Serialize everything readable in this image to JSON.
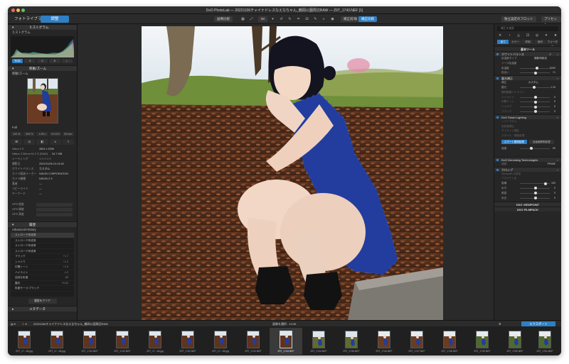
{
  "window": {
    "title": "DxO PhotoLab — 20221106チャイナドレスなえなちゃん_鶴岡公園周辺RAW — Z9T_1743.NEF [1]"
  },
  "toolbar": {
    "tab_library": "フォトライブラリ",
    "tab_customize": "調整",
    "btn_compare": "画像比較",
    "zoom_value": "50",
    "btn_before": "補正前/後",
    "btn_style": "補正比較",
    "btn_favorite": "独立設定のフロット",
    "btn_preset": "プリセット"
  },
  "left": {
    "histogram_title": "ヒストグラム",
    "histogram_sub": "ヒストグラム",
    "histogram_channels": [
      "RGB",
      "R",
      "G",
      "B",
      "L"
    ],
    "move_zoom_title": "移動/ズーム",
    "move_zoom_sub": "移動/ズーム",
    "zoom_label": "Full",
    "zoom_buttons": [
      "100 %",
      "200 %",
      "1:00 x",
      "+0.0 EV",
      "50 mm"
    ],
    "info_rows": [
      {
        "k": "Nikon Z 9",
        "v": "3504 x 5256"
      },
      {
        "k": "Nikkor Z 50mm f/1.2 S (RAW)",
        "v": "34.7 MB"
      },
      {
        "k": "レーティング",
        "v": "☆☆☆☆☆"
      },
      {
        "k": "撮影日",
        "v": "2022/11/06 10:13:48"
      },
      {
        "k": "ホワイトバランス",
        "v": "カスタム"
      },
      {
        "k": "カメラ製造メーカー",
        "v": "NIKON CORPORATION"
      },
      {
        "k": "カメラ機種",
        "v": "NIKON Z 9"
      },
      {
        "k": "著者",
        "v": "—"
      },
      {
        "k": "コピーライト",
        "v": "—"
      },
      {
        "k": "キーワード",
        "v": "—"
      }
    ],
    "gps_rows": [
      "GPS 経度",
      "GPS 緯度",
      "GPS 高度"
    ],
    "history_title": "履歴",
    "history_sub": "Advanced History",
    "history_items": [
      {
        "label": "ストローク作成済",
        "value": ""
      },
      {
        "label": "ストローク作成済",
        "value": ""
      },
      {
        "label": "ストローク作成済",
        "value": ""
      },
      {
        "label": "ストローク作成済",
        "value": ""
      },
      {
        "label": "ブラック",
        "value": "+1.7"
      },
      {
        "label": "シャドウ",
        "value": "+1.3"
      },
      {
        "label": "中間トーン",
        "value": "+1.0"
      },
      {
        "label": "ハイライト",
        "value": "-1.3"
      },
      {
        "label": "自然な彩度",
        "value": "-35"
      },
      {
        "label": "露光",
        "value": "+0.42"
      },
      {
        "label": "彩度モード/ブラック",
        "value": ""
      }
    ],
    "history_clear": "履歴をクリア",
    "metadata_title": "メタデータ"
  },
  "right": {
    "search_placeholder": "補正を検索",
    "tabs": [
      "全て",
      "カラー",
      "詳細",
      "幾何",
      "ウォーター"
    ],
    "basic_title": "基本ツール",
    "sections": [
      {
        "title": "ホワイトバランス",
        "rows": [
          {
            "k": "色温度タイプ",
            "v": "撮影時設定"
          },
          {
            "k": "ソース色温度",
            "v": ""
          },
          {
            "k": "色温度",
            "v": "5200"
          },
          {
            "k": "色合い",
            "v": "+1"
          }
        ]
      },
      {
        "title": "露光補正",
        "rows": [
          {
            "k": "補正",
            "v": "カスタム"
          },
          {
            "k": "露光",
            "v": "1.19"
          },
          {
            "k": "選択範囲ハイライト",
            "v": ""
          },
          {
            "k": "ハイライト",
            "v": "0"
          },
          {
            "k": "中間トーン",
            "v": "0"
          },
          {
            "k": "シャドウ",
            "v": "0"
          },
          {
            "k": "ブラック",
            "v": "0"
          }
        ]
      },
      {
        "title": "DxO Smart Lighting",
        "rows": []
      },
      {
        "title": "レンズシャープネス",
        "rows": [
          {
            "k": "シャープネス",
            "v": ""
          },
          {
            "k": "色収差補正",
            "v": ""
          },
          {
            "k": "ヴィネット補正",
            "v": ""
          },
          {
            "k": "スタイル・調色処理",
            "v": ""
          }
        ]
      },
      {
        "title": "DxO ClearView Plus",
        "rows": [
          {
            "k": "強度",
            "v": "50"
          }
        ]
      },
      {
        "title": "DxO Denoising Technologies",
        "rows": [
          {
            "k": "種類",
            "v": "PRIME"
          }
        ]
      },
      {
        "title": "クロップ",
        "rows": [
          {
            "k": "Viewpoint の設定",
            "v": ""
          },
          {
            "k": "アスペクト比",
            "v": ""
          },
          {
            "k": "縦横",
            "v": "100"
          },
          {
            "k": "水平",
            "v": "0"
          },
          {
            "k": "垂直",
            "v": "0"
          },
          {
            "k": "余白",
            "v": "0"
          }
        ]
      }
    ],
    "smart_buttons": [
      "スマート照明処理",
      "全画面照明処理"
    ],
    "viewpoint": "DXO VIEWPOINT",
    "filmpack": "DXO FILMPACK"
  },
  "filmstrip": {
    "folder": "20221106チャイナドレスなえなちゃん_鶴岡公園周辺RAW",
    "count": "画像を選択 : 1/135",
    "export": "エクスポート",
    "items": [
      "Z9T_17...06.jpg",
      "Z9T_17...08.jpg",
      "Z9T_1742.NEF",
      "Z9T_1742.NEF",
      "Z9T_17...06.jpg",
      "Z9T_1742.NEF",
      "Z9T_17...08.jpg",
      "Z9T_1742.NEF",
      "Z9T_1743.NEF",
      "Z9T_1744.NEF",
      "Z9T_1745.NEF",
      "Z9T_1746.NEF",
      "Z9T_1747.NEF",
      "Z9T_1748.NEF",
      "Z9T_1749.NEF",
      "Z9T_1750.NEF",
      "Z9T_1751.NEF"
    ]
  }
}
